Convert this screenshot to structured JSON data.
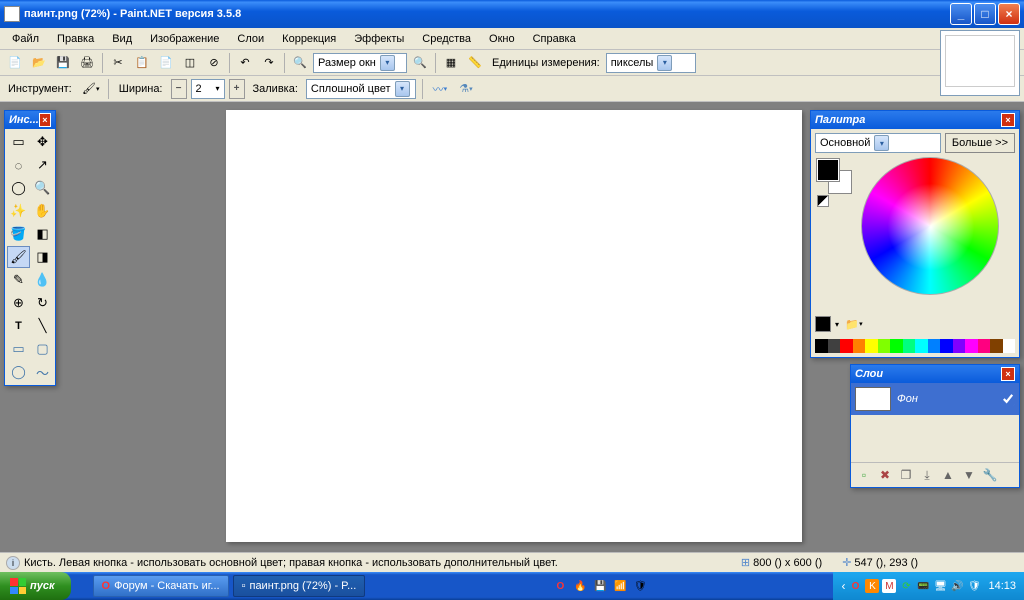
{
  "titlebar": {
    "title": "паинт.png (72%) - Paint.NET версия 3.5.8"
  },
  "menu": {
    "file": "Файл",
    "edit": "Правка",
    "view": "Вид",
    "image": "Изображение",
    "layers": "Слои",
    "adjustments": "Коррекция",
    "effects": "Эффекты",
    "tools": "Средства",
    "window": "Окно",
    "help": "Справка"
  },
  "toolbar": {
    "zoom_label": "Размер окн",
    "units_label": "Единицы измерения:",
    "units_value": "пикселы",
    "tool_label": "Инструмент:",
    "width_label": "Ширина:",
    "width_value": "2",
    "fill_label": "Заливка:",
    "fill_value": "Сплошной цвет"
  },
  "tools_window": {
    "title": "Инс..."
  },
  "palette_window": {
    "title": "Палитра",
    "primary_label": "Основной",
    "more_label": "Больше >>",
    "primary_color": "#000000",
    "secondary_color": "#ffffff",
    "strip": [
      "#000",
      "#404040",
      "#ff0000",
      "#ff8000",
      "#ffff00",
      "#80ff00",
      "#00ff00",
      "#00ff80",
      "#00ffff",
      "#0080ff",
      "#0000ff",
      "#8000ff",
      "#ff00ff",
      "#ff0080",
      "#804000",
      "#ffffff"
    ]
  },
  "layers_window": {
    "title": "Слои",
    "background": "Фон"
  },
  "statusbar": {
    "hint": "Кисть. Левая кнопка - использовать основной цвет; правая кнопка - использовать дополнительный цвет.",
    "canvas_size": "800 () x 600 ()",
    "cursor_pos": "547 (), 293 ()"
  },
  "taskbar": {
    "start": "пуск",
    "task1": "Форум - Скачать иг...",
    "task2": "паинт.png (72%) - P...",
    "clock": "14:13"
  }
}
